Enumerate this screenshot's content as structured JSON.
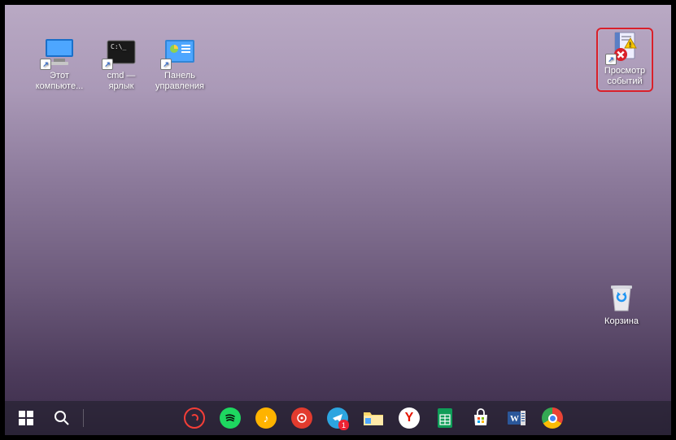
{
  "desktop": {
    "icons": [
      {
        "id": "this-pc",
        "label": "Этот компьюте..."
      },
      {
        "id": "cmd-shortcut",
        "label": "cmd — ярлык"
      },
      {
        "id": "control-panel",
        "label": "Панель управления"
      },
      {
        "id": "event-viewer",
        "label": "Просмотр событий"
      },
      {
        "id": "recycle-bin",
        "label": "Корзина"
      }
    ]
  },
  "taskbar": {
    "start_tooltip": "Пуск",
    "search_tooltip": "Поиск",
    "telegram_badge": "1",
    "items": [
      "pocketcasts",
      "spotify",
      "music",
      "torrent",
      "telegram",
      "explorer",
      "yandex",
      "sheets",
      "store",
      "word",
      "chrome"
    ]
  },
  "colors": {
    "highlight": "#d9202a",
    "taskbar_bg": "rgba(30,30,40,.55)"
  }
}
